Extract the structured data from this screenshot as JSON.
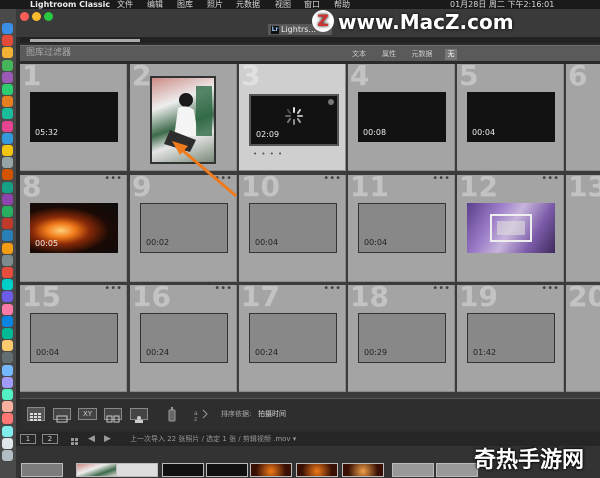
{
  "menubar": {
    "app_name": "Lightroom Classic",
    "items": [
      "文件",
      "编辑",
      "图库",
      "照片",
      "元数据",
      "视图",
      "窗口",
      "帮助"
    ],
    "datetime": "01月28日 周二 下午2:16:01"
  },
  "window": {
    "title": "Lightrs..."
  },
  "filter_bar": {
    "title": "图库过滤器",
    "buttons": [
      "文本",
      "属性",
      "元数据",
      "无"
    ]
  },
  "grid": {
    "cells": [
      {
        "num": "1",
        "duration": "05:32",
        "thumb": "dark",
        "dots": false,
        "selected": false
      },
      {
        "num": "2",
        "duration": "",
        "thumb": "photo",
        "dots": false,
        "selected": false
      },
      {
        "num": "3",
        "duration": "02:09",
        "thumb": "loading",
        "dots": false,
        "selected": true
      },
      {
        "num": "4",
        "duration": "00:08",
        "thumb": "dark",
        "dots": false,
        "selected": false
      },
      {
        "num": "5",
        "duration": "00:04",
        "thumb": "dark",
        "dots": false,
        "selected": false
      },
      {
        "num": "6",
        "duration": "",
        "thumb": "fire-edge",
        "dots": false,
        "selected": false
      },
      {
        "num": "8",
        "duration": "00:05",
        "thumb": "fire",
        "dots": true,
        "selected": false
      },
      {
        "num": "9",
        "duration": "00:02",
        "thumb": "grey",
        "dots": true,
        "selected": false
      },
      {
        "num": "10",
        "duration": "00:04",
        "thumb": "grey",
        "dots": true,
        "selected": false
      },
      {
        "num": "11",
        "duration": "00:04",
        "thumb": "grey",
        "dots": true,
        "selected": false
      },
      {
        "num": "12",
        "duration": "",
        "thumb": "purple",
        "dots": true,
        "selected": false
      },
      {
        "num": "13",
        "duration": "",
        "thumb": "purple-edge",
        "dots": false,
        "selected": false
      },
      {
        "num": "15",
        "duration": "00:04",
        "thumb": "grey",
        "dots": true,
        "selected": false
      },
      {
        "num": "16",
        "duration": "00:24",
        "thumb": "grey",
        "dots": true,
        "selected": false
      },
      {
        "num": "17",
        "duration": "00:24",
        "thumb": "grey",
        "dots": true,
        "selected": false
      },
      {
        "num": "18",
        "duration": "00:29",
        "thumb": "grey",
        "dots": true,
        "selected": false
      },
      {
        "num": "19",
        "duration": "01:42",
        "thumb": "grey",
        "dots": true,
        "selected": false
      },
      {
        "num": "20",
        "duration": "",
        "thumb": "grey-edge",
        "dots": true,
        "selected": false
      }
    ]
  },
  "toolbar": {
    "sort_label": "排序依据:",
    "sort_value": "拍摄时间"
  },
  "filmstrip": {
    "page1": "1",
    "page2": "2",
    "info": "上一次导入   22 张照片 / 选定 1 张 / 剪辑视频 .mov ▾"
  },
  "watermarks": {
    "top": "www.MacZ.com",
    "top_logo": "Z",
    "bottom": "奇热手游网"
  },
  "colors": {
    "window_bg": "#2b2b2b",
    "cell_bg": "#a4a4a4",
    "cell_selected_bg": "#cfcfcf",
    "arrow": "#f07a1a"
  }
}
